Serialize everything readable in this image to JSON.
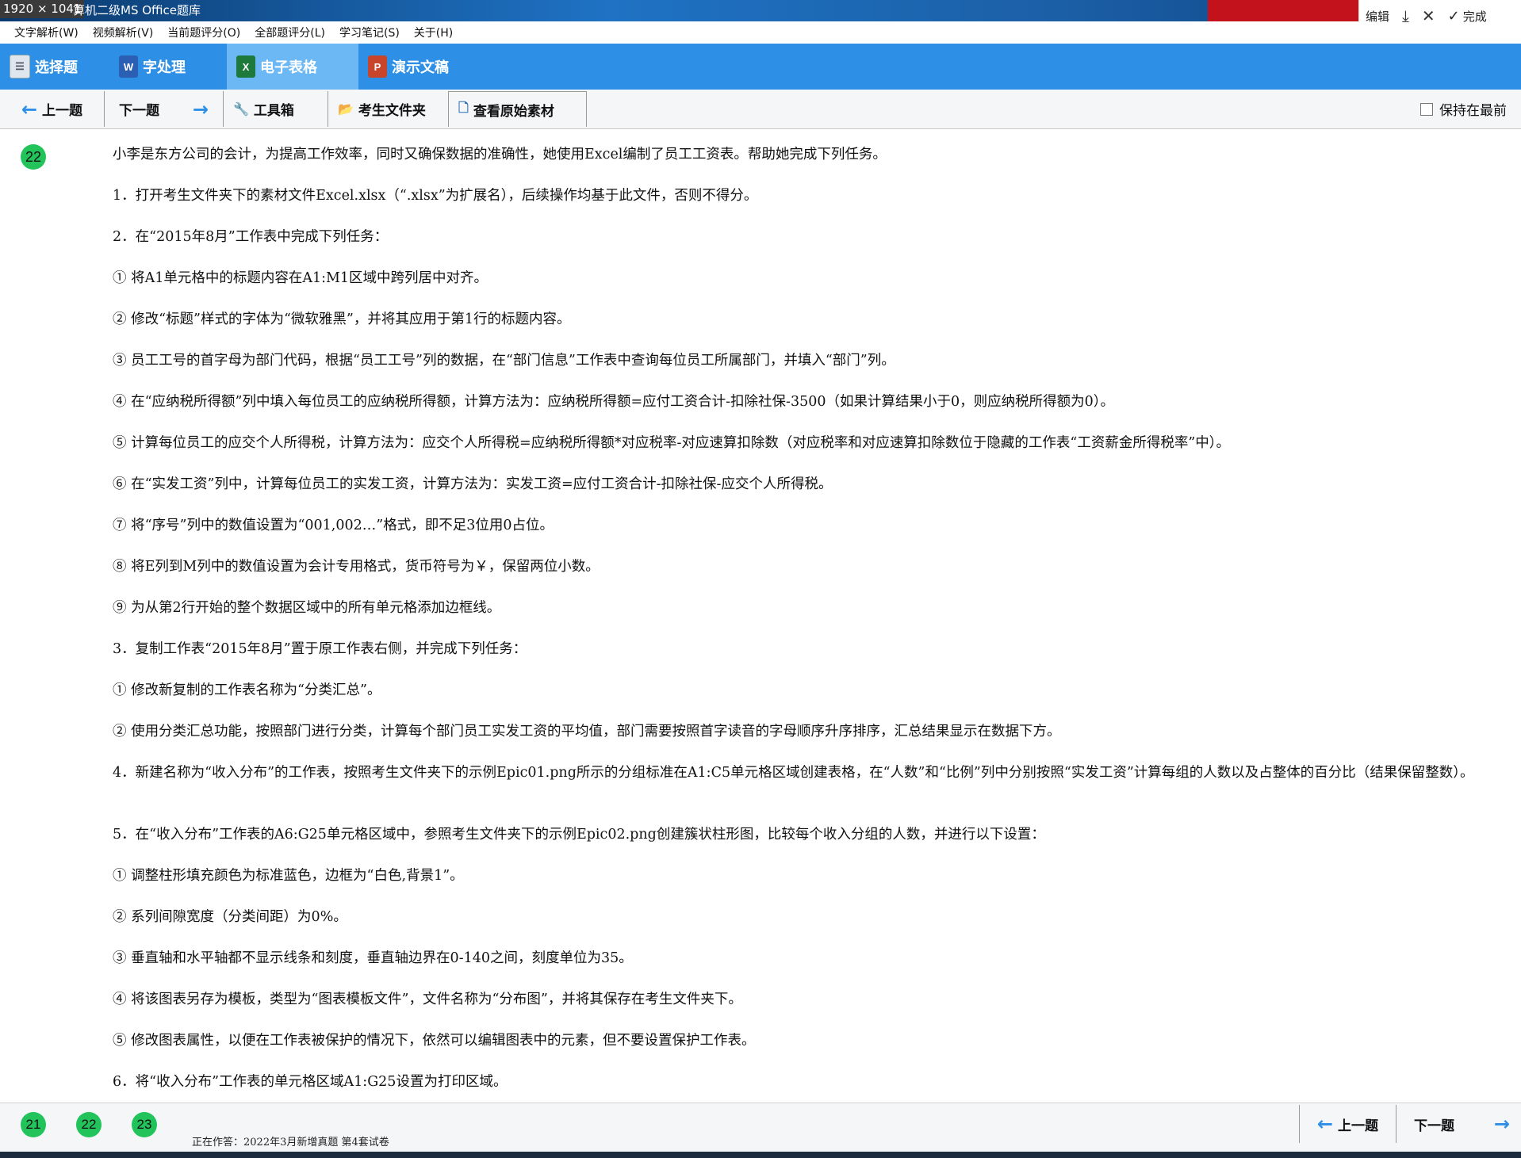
{
  "window": {
    "size_badge": "1920 × 1041",
    "title": "算机二级MS Office题库",
    "edit_label": "编辑",
    "done_label": "完成"
  },
  "menu": [
    "文字解析(W)",
    "视频解析(V)",
    "当前题评分(O)",
    "全部题评分(L)",
    "学习笔记(S)",
    "关于(H)"
  ],
  "modules": [
    {
      "label": "选择题",
      "icon": "list-icon"
    },
    {
      "label": "字处理",
      "icon": "word-icon",
      "icon_text": "W"
    },
    {
      "label": "电子表格",
      "icon": "excel-icon",
      "icon_text": "X",
      "active": true
    },
    {
      "label": "演示文稿",
      "icon": "ppt-icon",
      "icon_text": "P"
    }
  ],
  "toolbar": {
    "prev": "上一题",
    "next": "下一题",
    "tools": "工具箱",
    "folder": "考生文件夹",
    "view_source": "查看原始素材",
    "keep_front": "保持在最前"
  },
  "question": {
    "number": "22",
    "lines": [
      "小李是东方公司的会计，为提高工作效率，同时又确保数据的准确性，她使用Excel编制了员工工资表。帮助她完成下列任务。",
      "1．打开考生文件夹下的素材文件Excel.xlsx（“.xlsx”为扩展名），后续操作均基于此文件，否则不得分。",
      "2．在“2015年8月”工作表中完成下列任务：",
      "① 将A1单元格中的标题内容在A1:M1区域中跨列居中对齐。",
      "② 修改“标题”样式的字体为“微软雅黑”，并将其应用于第1行的标题内容。",
      "③ 员工工号的首字母为部门代码，根据“员工工号”列的数据，在“部门信息”工作表中查询每位员工所属部门，并填入“部门”列。",
      "④ 在“应纳税所得额”列中填入每位员工的应纳税所得额，计算方法为：应纳税所得额=应付工资合计-扣除社保-3500（如果计算结果小于0，则应纳税所得额为0）。",
      "⑤ 计算每位员工的应交个人所得税，计算方法为：应交个人所得税=应纳税所得额*对应税率-对应速算扣除数（对应税率和对应速算扣除数位于隐藏的工作表“工资薪金所得税率”中）。",
      "⑥ 在“实发工资”列中，计算每位员工的实发工资，计算方法为：实发工资=应付工资合计-扣除社保-应交个人所得税。",
      "⑦ 将“序号”列中的数值设置为“001,002…”格式，即不足3位用0占位。",
      "⑧ 将E列到M列中的数值设置为会计专用格式，货币符号为￥，保留两位小数。",
      "⑨ 为从第2行开始的整个数据区域中的所有单元格添加边框线。",
      "3．复制工作表“2015年8月”置于原工作表右侧，并完成下列任务：",
      "① 修改新复制的工作表名称为“分类汇总”。",
      "② 使用分类汇总功能，按照部门进行分类，计算每个部门员工实发工资的平均值，部门需要按照首字读音的字母顺序升序排序，汇总结果显示在数据下方。",
      "4．新建名称为“收入分布”的工作表，按照考生文件夹下的示例Epic01.png所示的分组标准在A1:C5单元格区域创建表格，在“人数”和“比例”列中分别按照“实发工资”计算每组的人数以及占整体的百分比（结果保留整数）。",
      "5．在“收入分布”工作表的A6:G25单元格区域中，参照考生文件夹下的示例Epic02.png创建簇状柱形图，比较每个收入分组的人数，并进行以下设置：",
      "① 调整柱形填充颜色为标准蓝色，边框为“白色,背景1”。",
      "② 系列间隙宽度（分类间距）为0%。",
      "③ 垂直轴和水平轴都不显示线条和刻度，垂直轴边界在0-140之间，刻度单位为35。",
      "④ 将该图表另存为模板，类型为“图表模板文件”，文件名称为“分布图”，并将其保存在考生文件夹下。",
      "⑤ 修改图表属性，以便在工作表被保护的情况下，依然可以编辑图表中的元素，但不要设置保护工作表。",
      "6．将“收入分布”工作表的单元格区域A1:G25设置为打印区域。"
    ]
  },
  "bottom": {
    "nav": [
      "21",
      "22",
      "23"
    ],
    "status": "正在作答：2022年3月新增真题 第4套试卷",
    "prev": "上一题",
    "next": "下一题"
  },
  "colors": {
    "module_bar": "#2d8fe6",
    "active_tab": "#6cb8f4",
    "badge_green": "#22c35a"
  }
}
